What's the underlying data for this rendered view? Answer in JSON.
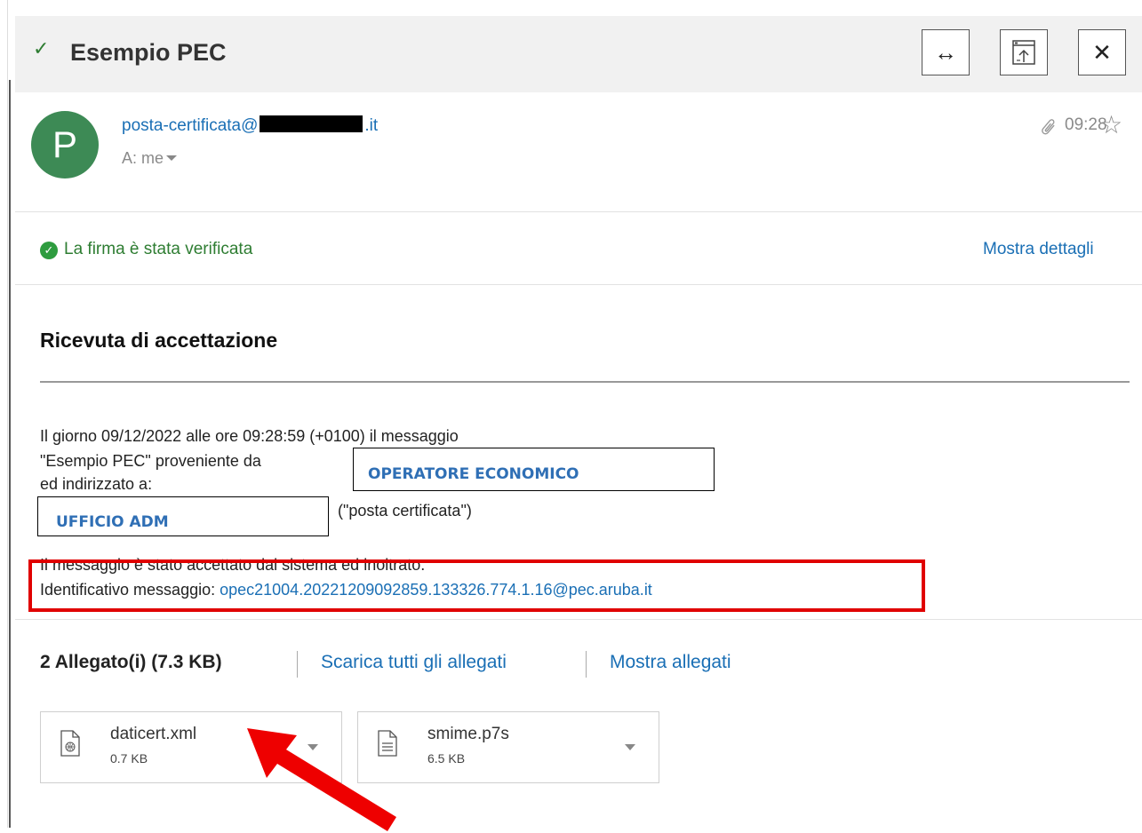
{
  "header": {
    "title": "Esempio PEC",
    "check_icon": "checkmark-icon",
    "buttons": {
      "expand": "↔",
      "popout_icon": "popout-window-icon",
      "close": "✕"
    }
  },
  "sender": {
    "avatar_letter": "P",
    "avatar_color": "#3d8a55",
    "email_prefix": "posta-certificata@",
    "email_suffix": ".it",
    "recipient": "A: me",
    "time": "09:28"
  },
  "signature": {
    "status_text": "La firma è stata verificata",
    "details_link": "Mostra dettagli"
  },
  "receipt": {
    "title": "Ricevuta di accettazione",
    "line1": "Il giorno 09/12/2022 alle ore 09:28:59 (+0100) il messaggio",
    "line2": "\"Esempio PEC\" proveniente da",
    "line3": "ed indirizzato a:",
    "sender_box": "OPERATORE ECONOMICO",
    "recipient_box": "UFFICIO ADM",
    "recipient_suffix": "(\"posta certificata\")",
    "accepted": "Il messaggio è stato accettato dal sistema ed inoltrato.",
    "id_label": "Identificativo messaggio: ",
    "id_value": "opec21004.20221209092859.133326.774.1.16@pec.aruba.it"
  },
  "attachments": {
    "summary": "2 Allegato(i) (7.3 KB)",
    "download_all": "Scarica tutti gli allegati",
    "show": "Mostra allegati",
    "files": [
      {
        "name": "daticert.xml",
        "size": "0.7 KB",
        "icon": "xml-file-icon"
      },
      {
        "name": "smime.p7s",
        "size": "6.5 KB",
        "icon": "text-file-icon"
      }
    ]
  },
  "colors": {
    "accent": "#1a6fb5",
    "success": "#2e7d32",
    "highlight": "#e00000"
  }
}
